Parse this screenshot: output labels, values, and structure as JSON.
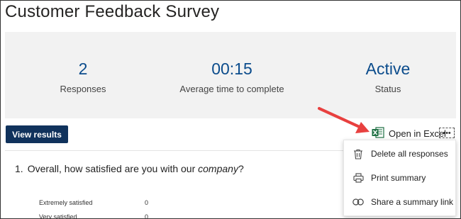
{
  "page": {
    "title": "Customer Feedback Survey"
  },
  "stats": [
    {
      "value": "2",
      "label": "Responses"
    },
    {
      "value": "00:15",
      "label": "Average time to complete"
    },
    {
      "value": "Active",
      "label": "Status"
    }
  ],
  "toolbar": {
    "view_results": "View results",
    "open_in_excel": "Open in Excel",
    "excel_icon": "excel-icon",
    "more_icon": "more-options-icon",
    "more_glyph": "•••"
  },
  "menu": {
    "items": [
      {
        "label": "Delete all responses",
        "icon": "trash-icon"
      },
      {
        "label": "Print summary",
        "icon": "printer-icon"
      },
      {
        "label": "Share a summary link",
        "icon": "link-icon"
      }
    ]
  },
  "question": {
    "number": "1.",
    "text_before": "Overall, how satisfied are you with our ",
    "emphasis": "company",
    "text_after": "?",
    "answers": [
      {
        "label": "Extremely satisfied",
        "count": "0"
      },
      {
        "label": "Very satisfied",
        "count": "0"
      }
    ]
  },
  "colors": {
    "accent": "#10325c",
    "stat_value": "#0b4c8c",
    "annotation_arrow": "#e8403f",
    "excel_green": "#1d6f42"
  }
}
